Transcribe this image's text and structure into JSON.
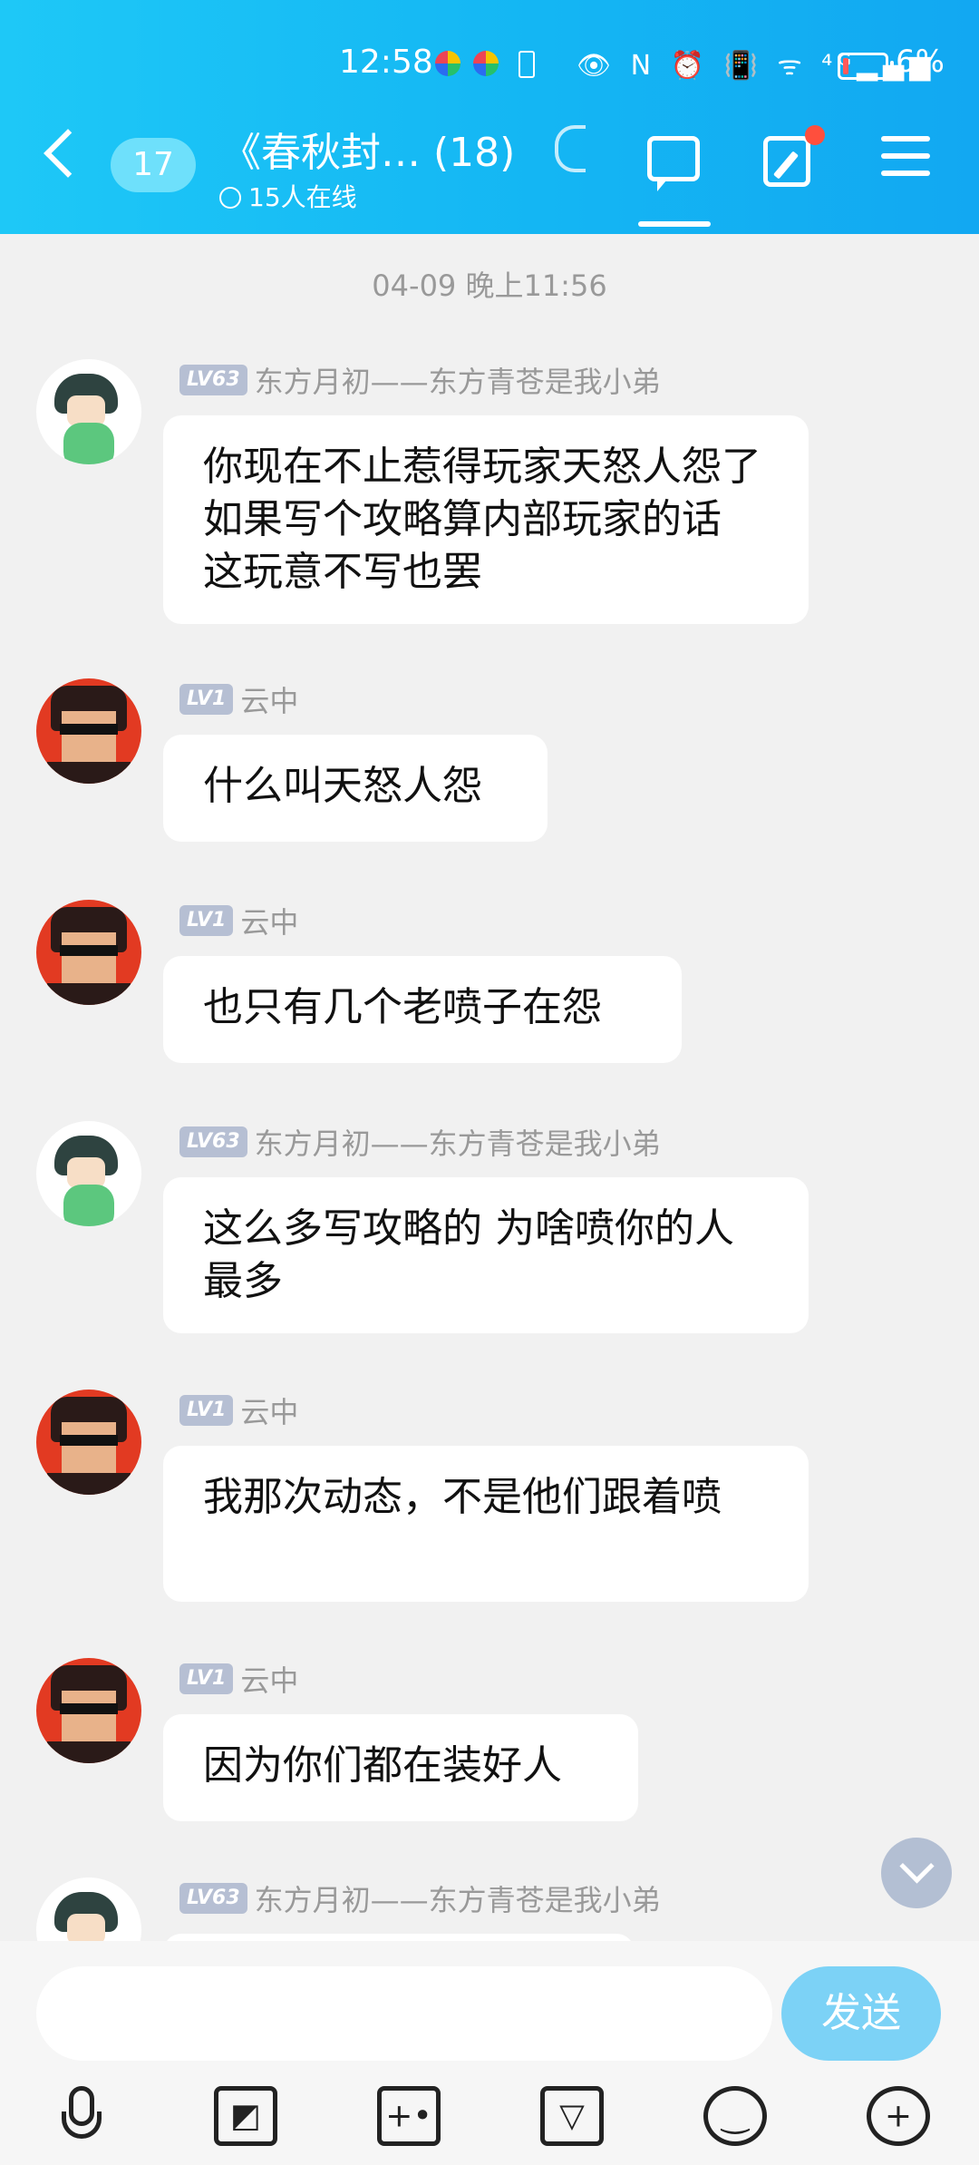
{
  "status_bar": {
    "time": "12:58",
    "icons": "👁 N ⏰ 📳 ᯤ ⁴ᴳ▂▄▆",
    "battery_percent": "6%"
  },
  "header": {
    "unread_count": "17",
    "group_title": "《春秋封…  (18)",
    "online_status": "15人在线"
  },
  "chat": {
    "timestamp": "04-09 晚上11:56",
    "messages": [
      {
        "level": "LV63",
        "name": "东方月初——东方青苍是我小弟",
        "text": "你现在不止惹得玩家天怒人怨了   如果写个攻略算内部玩家的话  这玩意不写也罢"
      },
      {
        "level": "LV1",
        "name": "云中",
        "text": "什么叫天怒人怨"
      },
      {
        "level": "LV1",
        "name": "云中",
        "text": "也只有几个老喷子在怨"
      },
      {
        "level": "LV63",
        "name": "东方月初——东方青苍是我小弟",
        "text": "这么多写攻略的   为啥喷你的人最多"
      },
      {
        "level": "LV1",
        "name": "云中",
        "text": "我那次动态，不是他们跟着喷"
      },
      {
        "level": "LV1",
        "name": "云中",
        "text": "因为你们都在装好人"
      },
      {
        "level": "LV63",
        "name": "东方月初——东方青苍是我小弟",
        "text": ""
      }
    ]
  },
  "input": {
    "placeholder": "",
    "send_label": "发送"
  },
  "toolbar": {
    "icons": [
      "microphone-icon",
      "image-icon",
      "camera-icon",
      "red-packet-icon",
      "emoji-icon",
      "plus-icon"
    ]
  },
  "colors": {
    "header_gradient": [
      "#1ec8f7",
      "#12a8f2"
    ],
    "send_button": "#7cd2f6",
    "level_badge": "#b6bfd3"
  }
}
